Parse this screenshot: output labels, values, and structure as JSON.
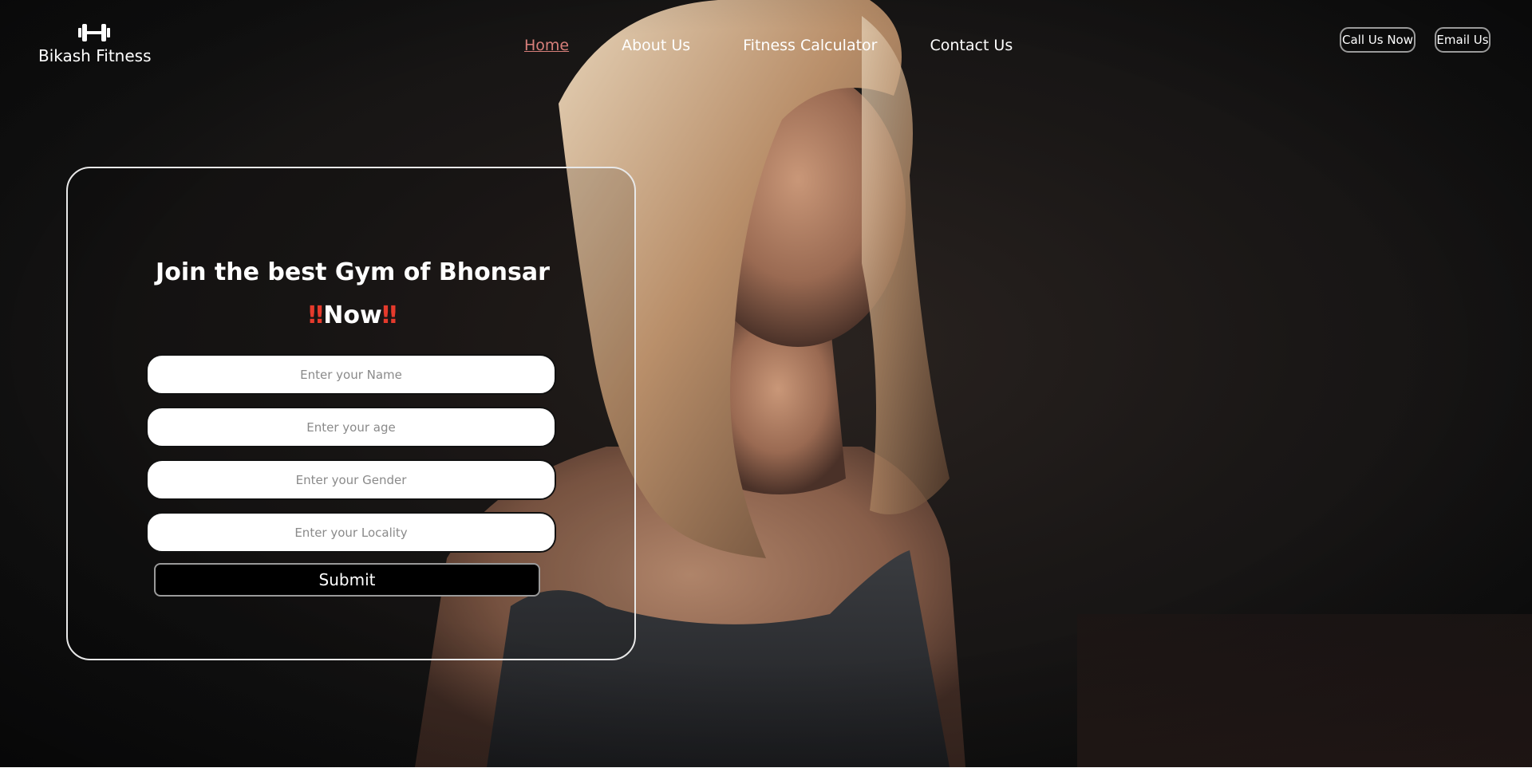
{
  "brand": {
    "name": "Bikash Fitness",
    "icon": "dumbbell-icon"
  },
  "nav": {
    "items": [
      {
        "label": "Home",
        "active": true
      },
      {
        "label": "About Us",
        "active": false
      },
      {
        "label": "Fitness Calculator",
        "active": false
      },
      {
        "label": "Contact Us",
        "active": false
      }
    ]
  },
  "header_actions": {
    "call": "Call Us Now",
    "email": "Email Us"
  },
  "form": {
    "title_line1": "Join the best Gym of Bhonsar",
    "title_bang_left": "‼",
    "title_line2": "Now",
    "title_bang_right": "‼",
    "fields": [
      {
        "placeholder": "Enter your Name",
        "value": ""
      },
      {
        "placeholder": "Enter your age",
        "value": ""
      },
      {
        "placeholder": "Enter your Gender",
        "value": ""
      },
      {
        "placeholder": "Enter your Locality",
        "value": ""
      }
    ],
    "submit_label": "Submit"
  },
  "colors": {
    "background": "#121212",
    "nav_active": "#d87f7a",
    "text": "#ffffff",
    "accent_exclaim": "#e53a2c"
  }
}
